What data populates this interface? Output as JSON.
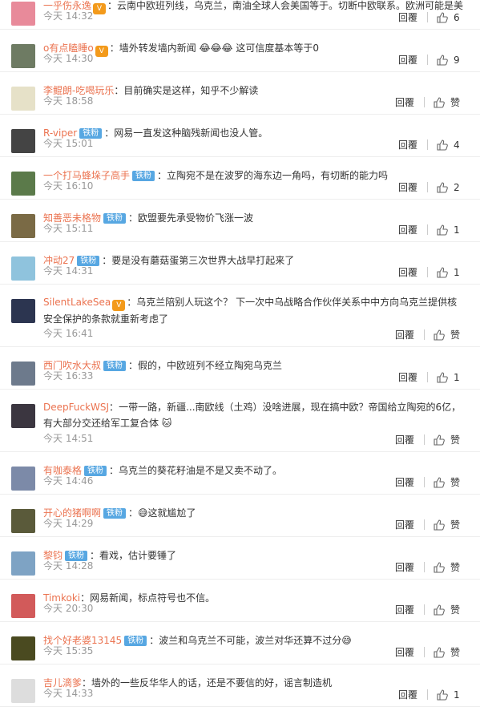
{
  "reply_label": "回覆",
  "badge_label": "铁粉",
  "comments": [
    {
      "user": "一乎伤永逸",
      "badge": "",
      "text": "云南中欧班列线，乌克兰，南油全球人会美国等于。切断中欧联系。欧洲可能是美国的短期目标。",
      "time": "今天 14:32",
      "likes": "6",
      "avatar_color": "#e88a9a",
      "vip": true
    },
    {
      "user": "o有点瞌睡o",
      "badge": "",
      "text": "墙外转发墙内新闻 😂😂😂 这可信度基本等于0",
      "time": "今天 14:30",
      "likes": "9",
      "avatar_color": "#6e7b63",
      "vip": true
    },
    {
      "user": "李鲲朗-吃喝玩乐",
      "badge": "",
      "text": "目前确实是这样，知乎不少解读",
      "time": "今天 18:58",
      "likes": "赞",
      "avatar_color": "#e6e1c8"
    },
    {
      "user": "R-viper",
      "badge": "铁粉",
      "text": "网易一直发这种脑残新闻也没人管。",
      "time": "今天 15:01",
      "likes": "4",
      "avatar_color": "#444444"
    },
    {
      "user": "一个打马蜂垛子高手",
      "badge": "铁粉",
      "text": "立陶宛不是在波罗的海东边一角吗，有切断的能力吗",
      "time": "今天 16:10",
      "likes": "2",
      "avatar_color": "#5b7a4a"
    },
    {
      "user": "知善恶未格物",
      "badge": "铁粉",
      "text": "欧盟要先承受物价飞涨一波",
      "time": "今天 15:11",
      "likes": "1",
      "avatar_color": "#7a6a45"
    },
    {
      "user": "冲动27",
      "badge": "铁粉",
      "text": "要是没有蘑菇蛋第三次世界大战早打起来了",
      "time": "今天 14:31",
      "likes": "1",
      "avatar_color": "#8fc3dd"
    },
    {
      "user": "SilentLakeSea",
      "badge": "",
      "text": "乌克兰陪别人玩这个？ 下一次中乌战略合作伙伴关系中中方向乌克兰提供核安全保护的条款就重新考虑了",
      "time": "今天 16:41",
      "likes": "赞",
      "avatar_color": "#2c3550",
      "vip": true,
      "tall": true
    },
    {
      "user": "西门吹水大叔",
      "badge": "铁粉",
      "text": "假的，中欧班列不经立陶宛乌克兰",
      "time": "今天 16:33",
      "likes": "1",
      "avatar_color": "#6d7a8c"
    },
    {
      "user": "DeepFuckWSJ",
      "badge": "",
      "text": "一带一路，新疆...南欧线（土鸡）没啥进展，现在搞中欧？帝国给立陶宛的6亿，有大部分交还给军工复合体 🐱",
      "time": "今天 14:51",
      "likes": "赞",
      "avatar_color": "#3b3640",
      "tall": true
    },
    {
      "user": "有咖泰格",
      "badge": "铁粉",
      "text": "乌克兰的葵花籽油是不是又卖不动了。",
      "time": "今天 14:46",
      "likes": "赞",
      "avatar_color": "#7c8aa8"
    },
    {
      "user": "开心的猪啊啊",
      "badge": "铁粉",
      "text": "😅这就尴尬了",
      "time": "今天 14:29",
      "likes": "赞",
      "avatar_color": "#5a5a3a"
    },
    {
      "user": "黎钧",
      "badge": "铁粉",
      "text": "看戏，估计要锤了",
      "time": "今天 14:28",
      "likes": "赞",
      "avatar_color": "#7ea3c4"
    },
    {
      "user": "Timkoki",
      "badge": "",
      "text": "网易新闻，标点符号也不信。",
      "time": "今天 20:30",
      "likes": "赞",
      "avatar_color": "#d25a5a"
    },
    {
      "user": "找个好老婆13145",
      "badge": "铁粉",
      "text": "波兰和乌克兰不可能，波兰对华还算不过分😅",
      "time": "今天 15:35",
      "likes": "赞",
      "avatar_color": "#4a4a20"
    },
    {
      "user": "吉儿滴爹",
      "badge": "",
      "text": "墙外的一些反华华人的话，还是不要信的好，谣言制造机",
      "time": "今天 14:33",
      "likes": "1",
      "avatar_color": "#dddddd"
    }
  ]
}
